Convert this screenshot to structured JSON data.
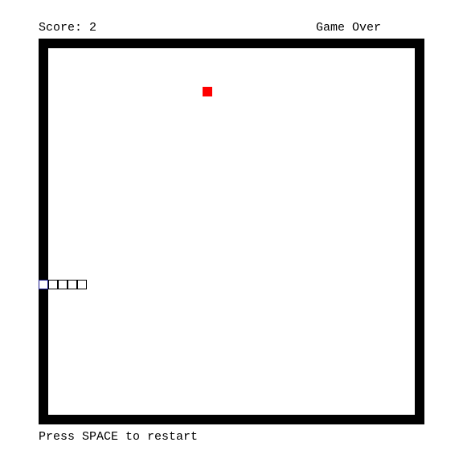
{
  "hud": {
    "score_text": "Score: 2",
    "status_text": "Game Over",
    "restart_text": "Press SPACE to restart"
  },
  "game": {
    "grid_columns": 38,
    "grid_rows": 38,
    "colors": {
      "wall": "#000000",
      "field": "#ffffff",
      "food": "#ff0000",
      "snake_head_outline": "#1a1a8c",
      "snake_body_outline": "#000000",
      "snake_fill": "#ffffff"
    },
    "food": {
      "col": 16,
      "row": 4
    },
    "snake": [
      {
        "col": -1,
        "row": 24
      },
      {
        "col": 0,
        "row": 24
      },
      {
        "col": 1,
        "row": 24
      },
      {
        "col": 2,
        "row": 24
      },
      {
        "col": 3,
        "row": 24
      }
    ]
  }
}
